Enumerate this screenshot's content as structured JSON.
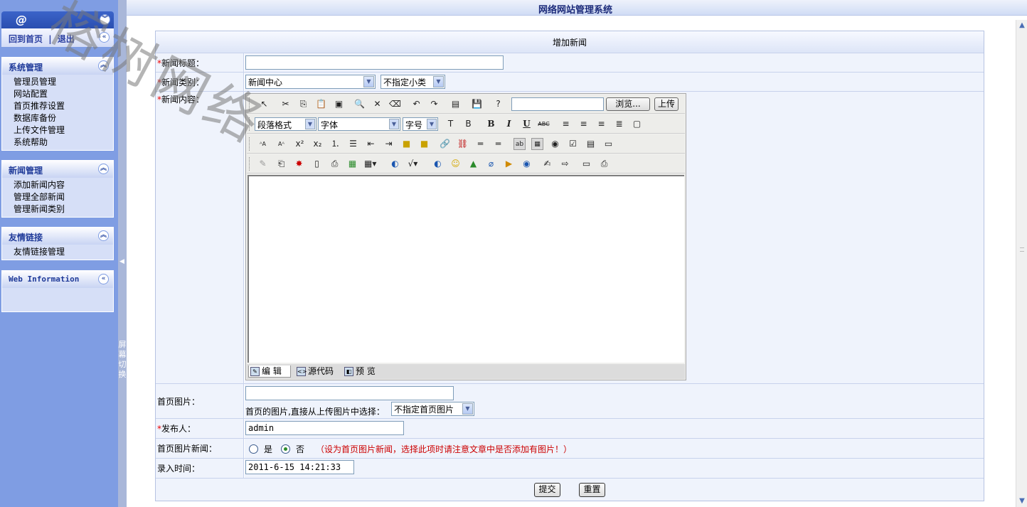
{
  "header": {
    "title": "网络网站管理系统"
  },
  "sidebar": {
    "top_symbol": "@",
    "home_link": "回到首页",
    "separator": "|",
    "logout_link": "退出",
    "panels": [
      {
        "title": "系统管理",
        "items": [
          "管理员管理",
          "网站配置",
          "首页推荐设置",
          "数据库备份",
          "上传文件管理",
          "系统帮助"
        ]
      },
      {
        "title": "新闻管理",
        "items": [
          "添加新闻内容",
          "管理全部新闻",
          "管理新闻类别"
        ]
      },
      {
        "title": "友情链接",
        "items": [
          "友情链接管理"
        ]
      },
      {
        "title": "Web Information",
        "items": []
      }
    ],
    "switch_label": "屏幕切换"
  },
  "watermark": "榕树网络",
  "form": {
    "heading": "增加新闻",
    "title_label": "新闻标题：",
    "title_value": "",
    "category_label": "新闻类别：",
    "category_selected": "新闻中心",
    "subcategory_selected": "不指定小类",
    "content_label": "新闻内容：",
    "editor": {
      "browse_button": "浏览...",
      "upload_button": "上传",
      "upload_path_value": "",
      "paragraph_format": "段落格式",
      "font_name": "字体",
      "font_size": "字号",
      "tabs": [
        "编 辑",
        "源代码",
        "预 览"
      ]
    },
    "image_label": "首页图片：",
    "image_value": "",
    "image_hint": "首页的图片,直接从上传图片中选择：",
    "image_select": "不指定首页图片",
    "publisher_label": "发布人：",
    "publisher_value": "admin",
    "image_news_label": "首页图片新闻：",
    "radio_yes": "是",
    "radio_no": "否",
    "radio_selected": "否",
    "image_news_hint": "（设为首页图片新闻，选择此项时请注意文章中是否添加有图片！）",
    "time_label": "录入时间：",
    "time_value": "2011-6-15 14:21:33",
    "submit_button": "提交",
    "reset_button": "重置",
    "required_mark": "*"
  },
  "colors": {
    "hint_red": "#cc0000",
    "sidebar_bg": "#7f9de3",
    "title_blue": "#1b2a7a"
  }
}
